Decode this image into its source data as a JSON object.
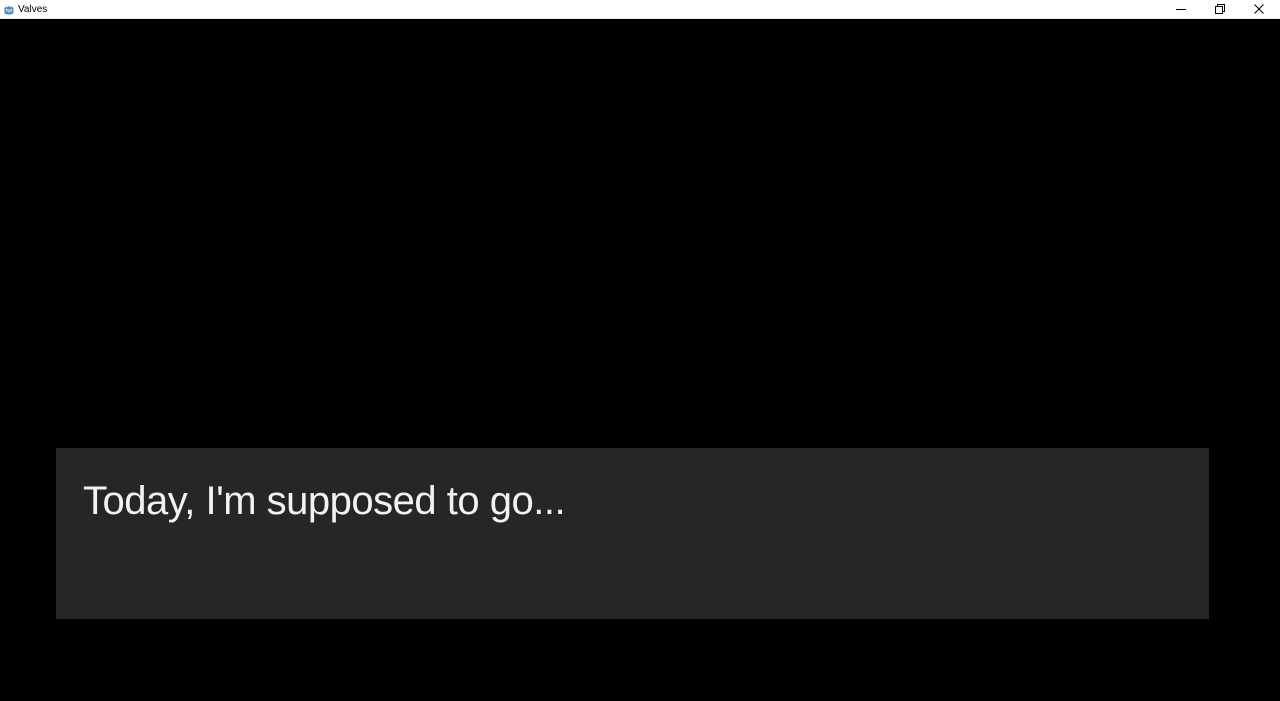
{
  "window": {
    "title": "Valves",
    "icon": "godot-engine-icon",
    "controls": {
      "minimize": "minimize-icon",
      "maximize": "restore-icon",
      "close": "close-icon"
    }
  },
  "game": {
    "background_color": "#000000",
    "dialog": {
      "text": "Today, I'm supposed to go...",
      "box_color": "#262626",
      "text_color": "#f2f2f2"
    }
  }
}
